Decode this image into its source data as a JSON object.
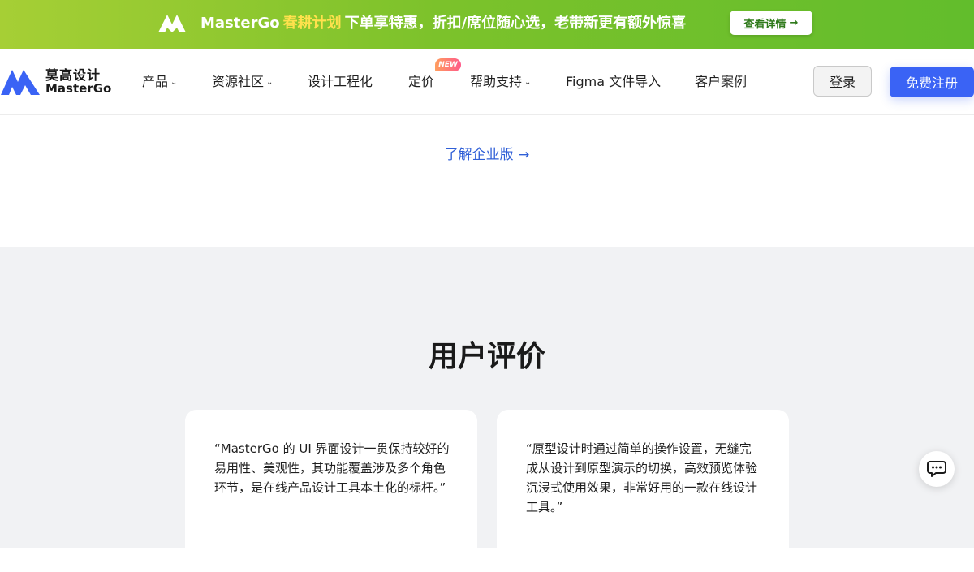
{
  "promo": {
    "brand": "MasterGo",
    "highlight": "春耕计划",
    "message": "下单享特惠，折扣/席位随心选，老带新更有额外惊喜",
    "button_label": "查看详情",
    "button_icon": "arrow-right-icon"
  },
  "nav": {
    "brand_cn": "莫高设计",
    "brand_en": "MasterGo",
    "items": [
      {
        "label": "产品",
        "has_dropdown": true
      },
      {
        "label": "资源社区",
        "has_dropdown": true
      },
      {
        "label": "设计工程化",
        "has_dropdown": false
      },
      {
        "label": "定价",
        "has_dropdown": false,
        "badge": "NEW"
      },
      {
        "label": "帮助支持",
        "has_dropdown": true
      },
      {
        "label": "Figma 文件导入",
        "has_dropdown": false
      },
      {
        "label": "客户案例",
        "has_dropdown": false
      }
    ],
    "login_label": "登录",
    "register_label": "免费注册"
  },
  "enterprise_link": "了解企业版",
  "reviews": {
    "title": "用户评价",
    "items": [
      {
        "quote": "“MasterGo 的 UI 界面设计一贯保持较好的易用性、美观性，其功能覆盖涉及多个角色环节，是在线产品设计工具本土化的标杆。”"
      },
      {
        "quote": "“原型设计时通过简单的操作设置，无缝完成从设计到原型演示的切换，高效预览体验沉浸式使用效果，非常好用的一款在线设计工具。”"
      }
    ]
  },
  "chat_icon": "chat-bubble-icon",
  "colors": {
    "primary": "#3a63f5",
    "link": "#2f5fd7",
    "promo_highlight": "#ffe14d",
    "section_bg": "#f1f2f4"
  }
}
